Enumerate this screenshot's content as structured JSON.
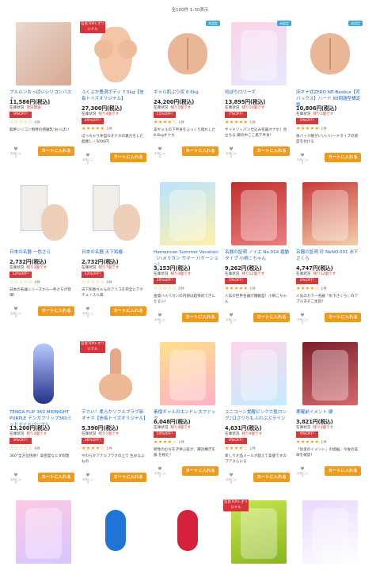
{
  "result_count": "全100件 1-30表示",
  "colors": {
    "link": "#1a64c8",
    "sale": "#d6393c",
    "cart": "#f09a1d",
    "star": "#f0a000"
  },
  "common": {
    "cart_label": "カートに入れる",
    "fav_small": "お気に入り"
  },
  "products": [
    {
      "name": "プルルンおっぱいシリコンバスト",
      "price": "11,586円(税込)",
      "stock": "在庫状況",
      "ship": "翌日発送",
      "off": "9%OFF!",
      "stars": "☆☆☆☆☆",
      "reviews": "0件",
      "desc": "超絶シリコン製特の感触乳!おっぱい",
      "badge": "",
      "art": "face"
    },
    {
      "name": "ふくよか豊満ボディ 7.5kg【信長トイズオリジナル】",
      "price": "27,300円(税込)",
      "stock": "在庫状況",
      "ship": "残り4個です",
      "off": "20%OFF!",
      "stars": "★★★★★",
      "reviews": "1件",
      "desc": "ぽっちゃり体型のオナホの魅力をした超癒し・5000円",
      "badge": "信長TOYs\nオリジナル",
      "art": "torso"
    },
    {
      "name": "ギャル肌ぷり尻 8.6kg",
      "price": "24,200円(税込)",
      "stock": "在庫状況",
      "ship": "残り1個です",
      "off": "11%OFF!",
      "stars": "★★★★☆",
      "reviews": "1件",
      "desc": "美ギャルの下半身をふっくり再れした8.6kgオナホ",
      "badge": "",
      "badge_new": "未認定",
      "art": "butt"
    },
    {
      "name": "初ぽちロリーズ",
      "price": "13,895円(税込)",
      "stock": "在庫状況",
      "ship": "残り10個です",
      "off": "7%OFF!",
      "stars": "★★★★★",
      "reviews": "1件",
      "desc": "サイドゾッパン仕込み名器オナホ！見立ちる 脚の中ここ奥下半身！",
      "badge": "",
      "badge_new": "未認定",
      "art": "anime-pink"
    },
    {
      "name": "床オナ式ZERO NE-Basbus【背バックス】ハード 80問題型構定版",
      "price": "10,806円(税込)",
      "stock": "在庫状況",
      "ship": "残り1個です",
      "off": "8%OFF!",
      "stars": "★★★★★",
      "reviews": "1件",
      "desc": "後バック腰がいいいハードタイプの感度を付ける",
      "badge": "",
      "badge_new": "未認定",
      "art": "butt-sm"
    },
    {
      "name": "日本の名器 一色さら",
      "price": "2,732円(税込)",
      "stock": "在庫状況",
      "ship": "残り3個です",
      "off": "12%OFF!",
      "stars": "☆☆☆☆☆",
      "reviews": "0件",
      "desc": "日本の名器シリーズから一色さらが登場！",
      "badge": "",
      "art": "box-white"
    },
    {
      "name": "日本の名器 天下和春",
      "price": "2,732円(税込)",
      "stock": "在庫状況",
      "ship": "残り7個です",
      "off": "12%OFF!",
      "stars": "☆☆☆☆☆",
      "reviews": "0件",
      "desc": "天下和春ちゃんのアソコを完全にアクテュ・スル再",
      "badge": "",
      "art": "box-white2"
    },
    {
      "name": "Hamerican Summer Vacation（ハメリカン サマー バケーション）",
      "price": "3,153円(税込)",
      "stock": "在庫状況",
      "ship": "残り3個です",
      "off": "10%OFF!",
      "stars": "☆☆☆☆☆",
      "reviews": "0件",
      "desc": "金発ハメリカンの内部は超快的てきにたるシ！",
      "badge": "",
      "art": "anime-blue"
    },
    {
      "name": "名器の証明 ノイエ No.014 霜動タイプ 小柳こちゃん",
      "price": "9,262円(税込)",
      "stock": "在庫状況",
      "ship": "残り12個です",
      "off": "5%OFF!",
      "stars": "★★★★★",
      "reviews": "1件",
      "desc": "人気の世界名器が霜動型！小柳こちゃん",
      "badge": "",
      "art": "box-red"
    },
    {
      "name": "名器の証明 珍 NeNO.001 氷下さくら",
      "price": "4,747円(税込)",
      "stock": "在庫状況",
      "ship": "残り12個です",
      "off": "8%OFF!",
      "stars": "★★★★☆",
      "reviews": "1件",
      "desc": "人気のカラー名器『氷下さくら』のアプルあそこ生誕！",
      "badge": "",
      "art": "box-red2"
    },
    {
      "name": "TENGA FLIP 360 MIDNIGHT PURPLE テンガフリップ360ミッドナイトパープル",
      "price": "13,200円(税込)",
      "stock": "在庫状況",
      "ship": "残り3個です",
      "off": "8%OFF!",
      "stars": "☆☆☆☆☆",
      "reviews": "0件",
      "desc": "360°全方位快感！高密度なヒダ刺激",
      "badge": "",
      "art": "tenga"
    },
    {
      "name": "デカい！柔らかソフルプラグ新オナホ【信長トイズオリジナル】",
      "price": "5,390円(税込)",
      "stock": "在庫状況",
      "ship": "残り1個です",
      "off": "26%OFF!",
      "stars": "★★★★☆",
      "reviews": "1件",
      "desc": "やわらかアナルプラグの上で 生おなぶもの",
      "badge": "信長TOYs\nオリジナル",
      "art": "plug"
    },
    {
      "name": "素煌ギャルのエンドレスファック",
      "price": "6,048円(税込)",
      "stock": "在庫状況",
      "ship": "残り4個です",
      "off": "10%OFF!",
      "stars": "★★★★☆",
      "reviews": "1件",
      "desc": "新性のむちを子供ぶ鉱が、陣流構ぎを膝 を極た！",
      "badge": "",
      "art": "anime-gold"
    },
    {
      "name": "ユニコーン覚醒ピンクカ覧ロング♪口さりちもふわぶぶライン",
      "price": "4,631円(税込)",
      "stock": "在庫状況",
      "ship": "残り9個です",
      "off": "9%OFF!",
      "stars": "★★★★☆",
      "reviews": "1件",
      "desc": "新しりオ品メールが超えて高値ですのプアさらにる",
      "badge": "",
      "art": "anime-pastel"
    },
    {
      "name": "悪羅前イメント 硬",
      "price": "3,821円(税込)",
      "stock": "在庫状況",
      "ship": "残り4個です",
      "off": "9%OFF!",
      "stars": "★★★★★",
      "reviews": "1件",
      "desc": "「甘美のイメント」の続編。今後の美味を確認！",
      "badge": "",
      "art": "anime-dark"
    },
    {
      "name": "",
      "price": "",
      "stock": "",
      "ship": "",
      "off": "",
      "stars": "",
      "reviews": "",
      "desc": "",
      "badge": "",
      "art": "anime-pink2"
    },
    {
      "name": "",
      "price": "",
      "stock": "",
      "ship": "",
      "off": "",
      "stars": "",
      "reviews": "",
      "desc": "",
      "badge": "",
      "art": "fusion-blue"
    },
    {
      "name": "",
      "price": "",
      "stock": "",
      "ship": "",
      "off": "",
      "stars": "",
      "reviews": "",
      "desc": "",
      "badge": "",
      "art": "fusion-red"
    },
    {
      "name": "",
      "price": "",
      "stock": "",
      "ship": "",
      "off": "",
      "stars": "",
      "reviews": "",
      "desc": "",
      "badge": "信長TOYs\nオリジナル",
      "art": "lime-box"
    },
    {
      "name": "",
      "price": "",
      "stock": "",
      "ship": "",
      "off": "",
      "stars": "",
      "reviews": "",
      "desc": "",
      "badge": "",
      "art": "anime-purple"
    }
  ]
}
